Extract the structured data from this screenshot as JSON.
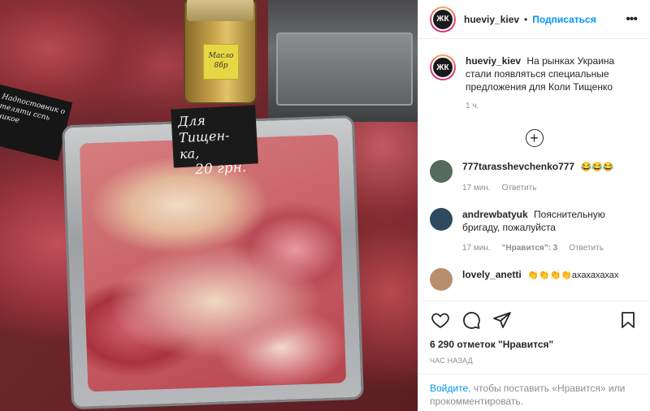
{
  "header": {
    "username": "hueviy_kiev",
    "separator": "•",
    "follow_label": "Подписаться",
    "more_label": "•••",
    "avatar_text": "ЖК"
  },
  "photo": {
    "price_sign_line1": "Для Тищен-",
    "price_sign_line2": "ка,",
    "price_sign_price": "20 грн.",
    "left_sign_text": "Надпостовник о теляти сспь никое",
    "jar_label": "Масло 8бр"
  },
  "caption": {
    "username": "hueviy_kiev",
    "text": "На рынках Украина стали появляться специальные предложения для Коли Тищенко",
    "time": "1 ч."
  },
  "comments": [
    {
      "username": "777tarasshevchenko777",
      "text": "😂😂😂",
      "time": "17 мин.",
      "reply": "Ответить",
      "avatar_color": "#556b5a"
    },
    {
      "username": "andrewbatyuk",
      "text": "Пояснительную бригаду, пожалуйста",
      "time": "17 мин.",
      "likes": "\"Нравится\": 3",
      "reply": "Ответить",
      "avatar_color": "#2e4a5e"
    },
    {
      "username": "lovely_anetti",
      "text": "👏👏👏👏ахахахахах",
      "avatar_color": "#b89070"
    }
  ],
  "actions": {
    "like_icon": "heart-icon",
    "comment_icon": "comment-icon",
    "share_icon": "share-icon",
    "save_icon": "bookmark-icon",
    "likes_text": "6 290 отметок \"Нравится\"",
    "post_time": "ЧАС НАЗАД"
  },
  "login": {
    "link": "Войдите",
    "text": ", чтобы поставить «Нравится» или прокомментировать."
  },
  "colors": {
    "accent": "#0095f6",
    "muted": "#8e8e8e",
    "text": "#262626"
  }
}
